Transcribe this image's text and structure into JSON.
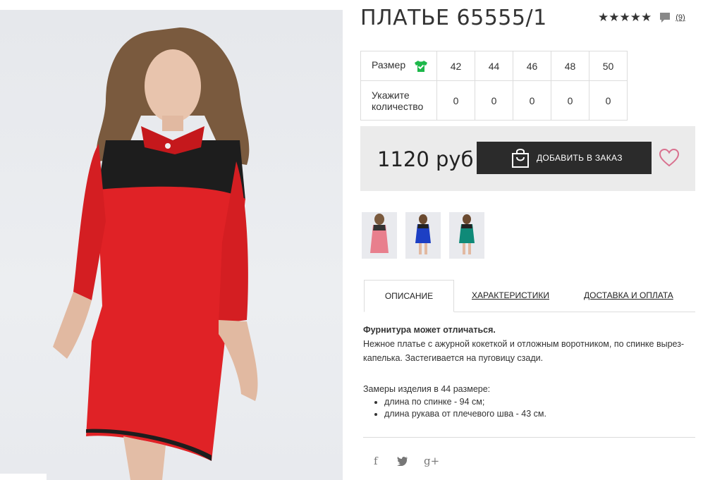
{
  "product": {
    "title": "ПЛАТЬЕ 65555/1",
    "stars": "★★★★★",
    "reviews_count": "(9)",
    "rating": 5
  },
  "sizes": {
    "size_label": "Размер",
    "qty_label": "Укажите количество",
    "values": [
      "42",
      "44",
      "46",
      "48",
      "50"
    ],
    "quantities": [
      "0",
      "0",
      "0",
      "0",
      "0"
    ]
  },
  "price": {
    "amount": "1120 руб",
    "add_to_order": "ДОБАВИТЬ В ЗАКАЗ"
  },
  "tabs": {
    "description": "ОПИСАНИЕ",
    "specs": "ХАРАКТЕРИСТИКИ",
    "delivery": "ДОСТАВКА И ОПЛАТА"
  },
  "description": {
    "note": "Фурнитура может отличаться.",
    "text": "Нежное платье с ажурной кокеткой и отложным воротником, по спинке вырез-капелька. Застегивается на пуговицу сзади.",
    "measure_title": "Замеры изделия в 44 размере:",
    "measures": [
      "длина по спинке - 94 см;",
      "длина рукава от плечевого шва - 43 см."
    ]
  },
  "social": {
    "facebook": "f",
    "twitter": "🐦",
    "gplus": "g+"
  },
  "colors": {
    "dress_red": "#e02226",
    "dress_blue": "#1c3fc4",
    "dress_green": "#0f8a78",
    "accent_pink": "#d9718f",
    "size_check_green": "#1db84a"
  },
  "icons": [
    "star-icon",
    "comment-icon",
    "shirt-check-icon",
    "bag-icon",
    "heart-icon",
    "facebook-icon",
    "twitter-icon",
    "gplus-icon"
  ]
}
